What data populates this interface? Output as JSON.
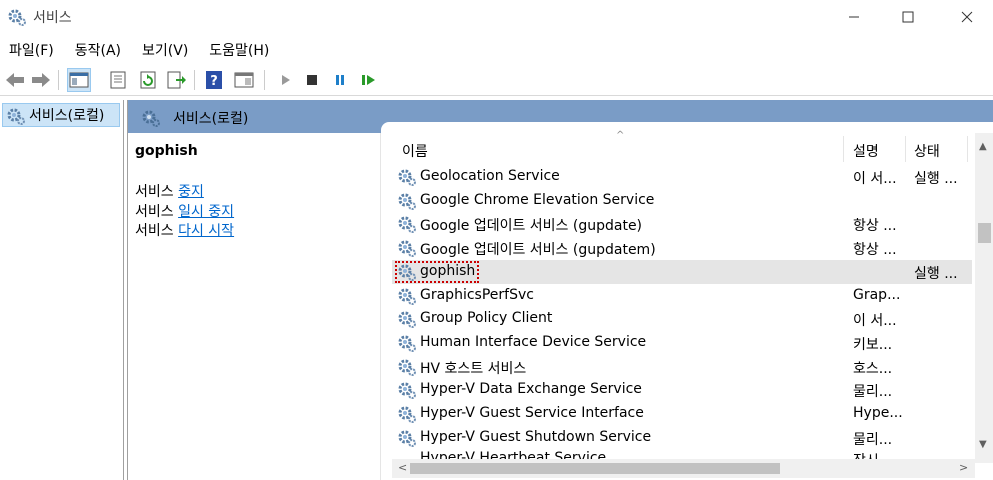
{
  "window": {
    "title": "서비스",
    "minimize": "—",
    "maximize": "☐",
    "close": "✕"
  },
  "menu": [
    {
      "label": "파일(F)"
    },
    {
      "label": "동작(A)"
    },
    {
      "label": "보기(V)"
    },
    {
      "label": "도움말(H)"
    }
  ],
  "toolbar": {
    "icons": [
      "back-arrow-icon",
      "forward-arrow-icon",
      "console-tree-icon",
      "properties-icon",
      "refresh-icon",
      "export-list-icon",
      "help-icon",
      "show-hide-pane-icon",
      "start-service-icon",
      "stop-service-icon",
      "pause-service-icon",
      "restart-service-icon"
    ],
    "help_glyph": "?"
  },
  "tree": {
    "root_label": "서비스(로컬)"
  },
  "header": {
    "label": "서비스(로컬)"
  },
  "extended": {
    "selected_name": "gophish",
    "actions": [
      {
        "prefix": "서비스 ",
        "link": "중지"
      },
      {
        "prefix": "서비스 ",
        "link": "일시 중지"
      },
      {
        "prefix": "서비스 ",
        "link": "다시 시작"
      }
    ]
  },
  "columns": {
    "name": "이름",
    "description": "설명",
    "status": "상태",
    "sort_arrow": "^"
  },
  "rows": [
    {
      "name": "Geolocation Service",
      "desc": "이 서...",
      "status": "실행 ..."
    },
    {
      "name": "Google Chrome Elevation Service",
      "desc": "",
      "status": ""
    },
    {
      "name": "Google 업데이트 서비스 (gupdate)",
      "desc": "항상 ...",
      "status": ""
    },
    {
      "name": "Google 업데이트 서비스 (gupdatem)",
      "desc": "항상 ...",
      "status": ""
    },
    {
      "name": "gophish",
      "desc": "",
      "status": "실행 ..."
    },
    {
      "name": "GraphicsPerfSvc",
      "desc": "Grap...",
      "status": ""
    },
    {
      "name": "Group Policy Client",
      "desc": "이 서...",
      "status": ""
    },
    {
      "name": "Human Interface Device Service",
      "desc": "키보...",
      "status": ""
    },
    {
      "name": "HV 호스트 서비스",
      "desc": "호스...",
      "status": ""
    },
    {
      "name": "Hyper-V Data Exchange Service",
      "desc": "물리...",
      "status": ""
    },
    {
      "name": "Hyper-V Guest Service Interface",
      "desc": "Hype...",
      "status": ""
    },
    {
      "name": "Hyper-V Guest Shutdown Service",
      "desc": "물리...",
      "status": ""
    }
  ],
  "selected_row_index": 4,
  "clipped_row": {
    "name": "Hyper-V Heartbeat Service",
    "desc": "잠시..."
  },
  "scroll": {
    "up": "▲",
    "down": "▼",
    "left": "<",
    "right": ">"
  }
}
